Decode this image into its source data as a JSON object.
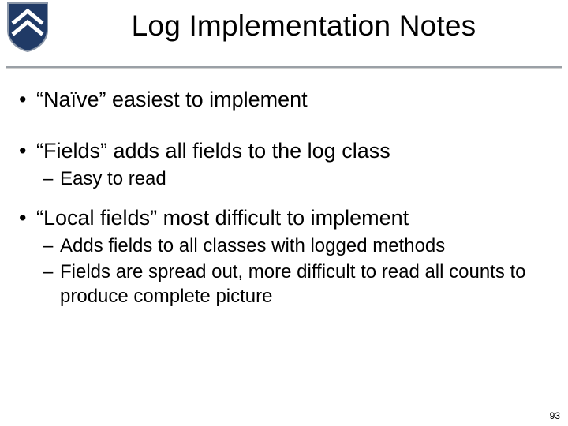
{
  "title": "Log Implementation Notes",
  "bullets": {
    "b1": "“Naïve” easiest to implement",
    "b2": "“Fields” adds all fields to the log class",
    "b2s1": "Easy to read",
    "b3": "“Local fields” most difficult to implement",
    "b3s1": "Adds fields to all classes with logged methods",
    "b3s2": "Fields are spread out, more difficult to read all counts to produce complete picture"
  },
  "page_number": "93",
  "logo": {
    "shield_fill": "#203a66",
    "chevron": "#ffffff"
  }
}
